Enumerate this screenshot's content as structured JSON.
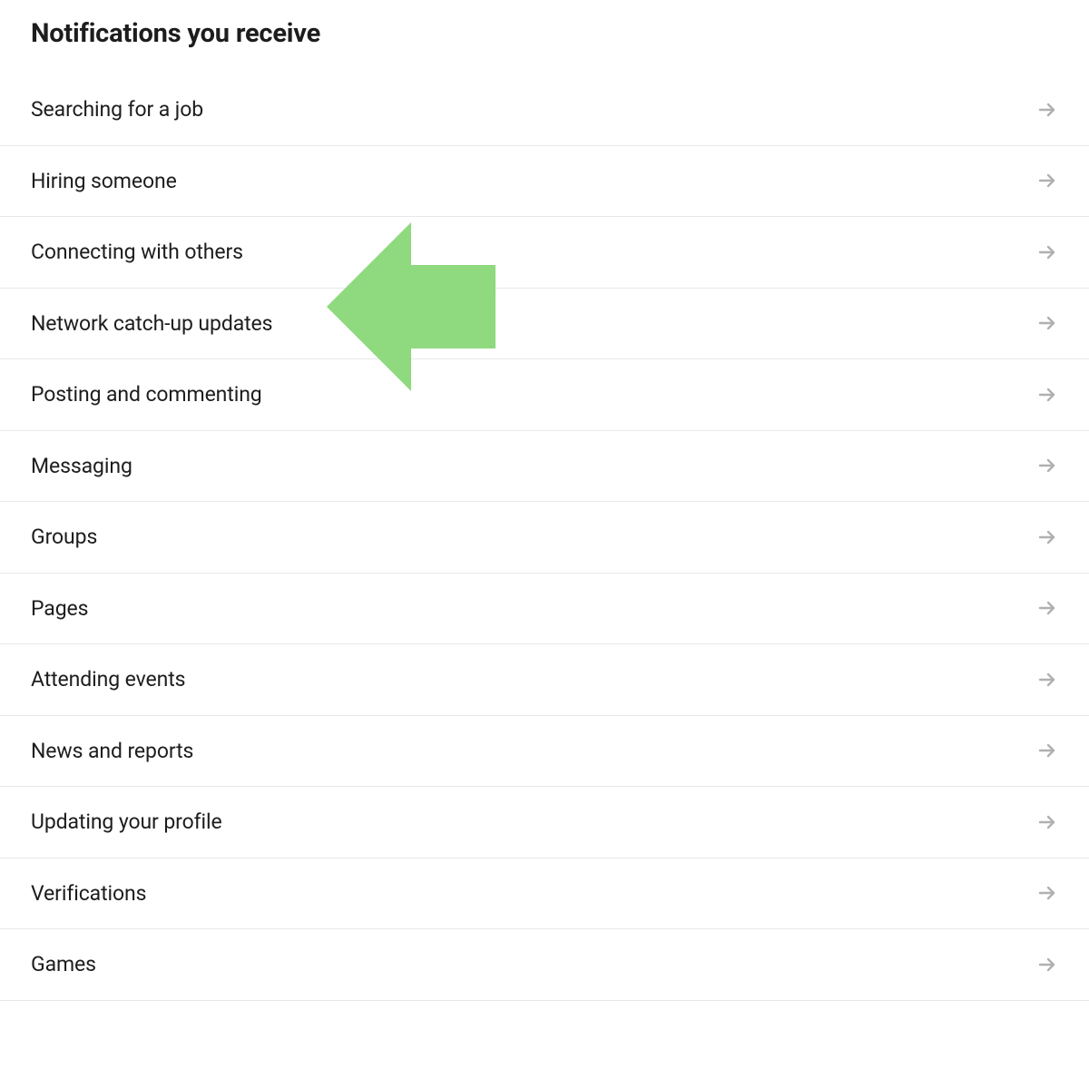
{
  "title": "Notifications you receive",
  "items": [
    {
      "label": "Searching for a job",
      "slug": "searching-for-a-job"
    },
    {
      "label": "Hiring someone",
      "slug": "hiring-someone"
    },
    {
      "label": "Connecting with others",
      "slug": "connecting-with-others"
    },
    {
      "label": "Network catch-up updates",
      "slug": "network-catch-up-updates"
    },
    {
      "label": "Posting and commenting",
      "slug": "posting-and-commenting"
    },
    {
      "label": "Messaging",
      "slug": "messaging"
    },
    {
      "label": "Groups",
      "slug": "groups"
    },
    {
      "label": "Pages",
      "slug": "pages"
    },
    {
      "label": "Attending events",
      "slug": "attending-events"
    },
    {
      "label": "News and reports",
      "slug": "news-and-reports"
    },
    {
      "label": "Updating your profile",
      "slug": "updating-your-profile"
    },
    {
      "label": "Verifications",
      "slug": "verifications"
    },
    {
      "label": "Games",
      "slug": "games"
    }
  ],
  "callout": {
    "color": "#8fd97e",
    "points_to_index": 3
  }
}
